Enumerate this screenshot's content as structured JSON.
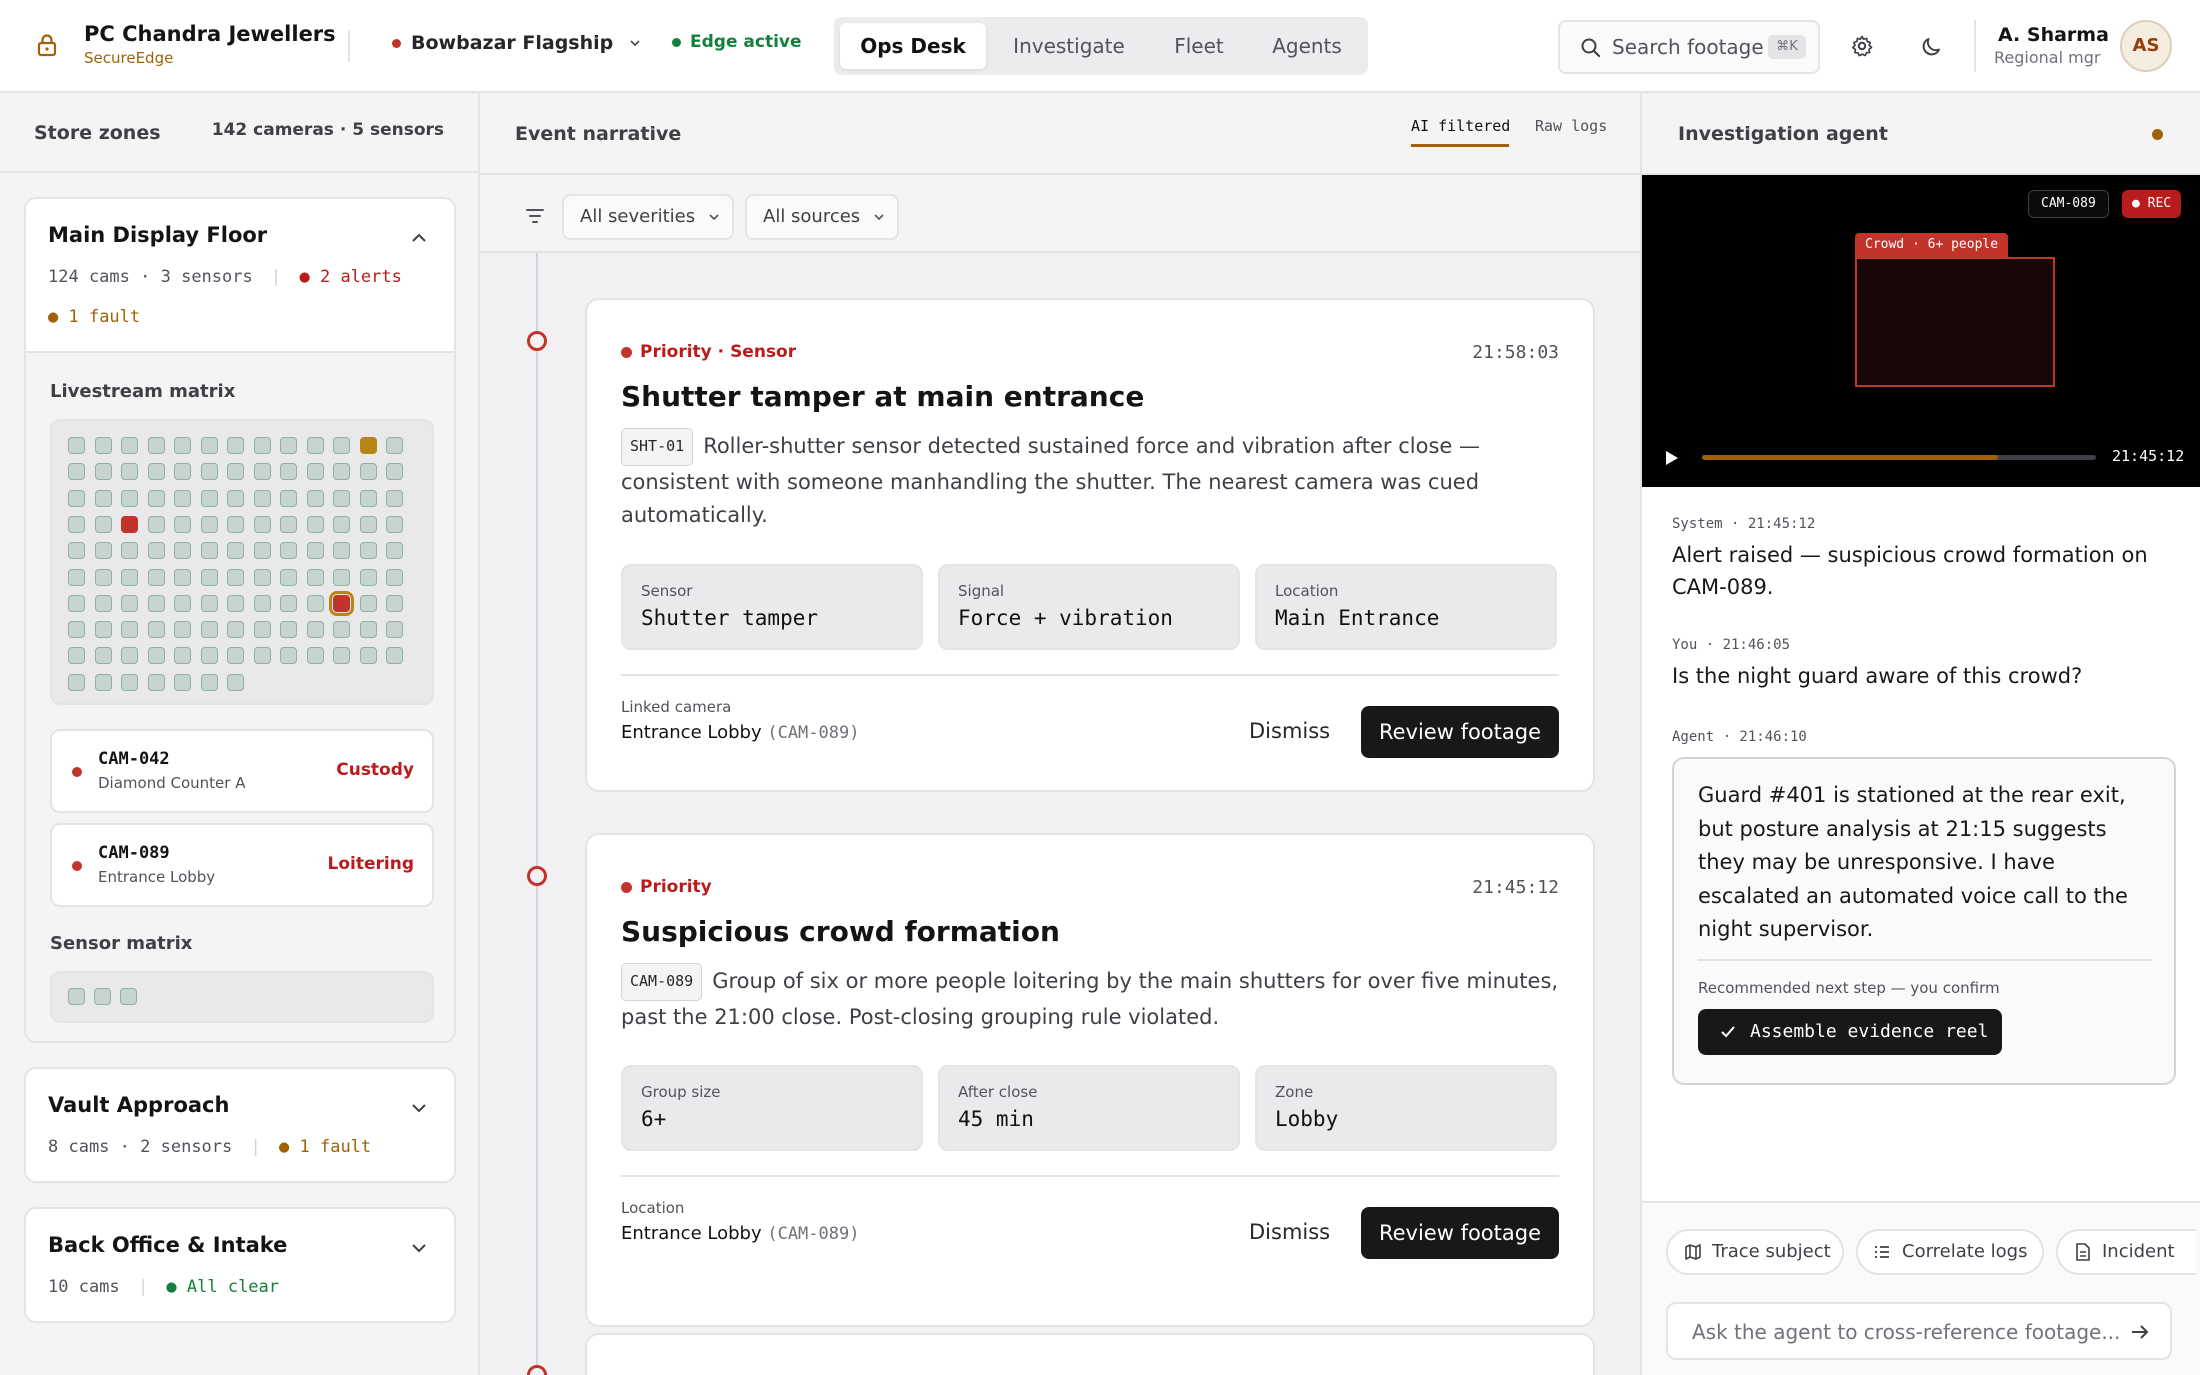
{
  "header": {
    "brand_name": "PC Chandra Jewellers",
    "brand_sub": "SecureEdge",
    "store": "Bowbazar Flagship",
    "edge_status": "Edge active",
    "tabs": [
      {
        "label": "Ops Desk",
        "active": true
      },
      {
        "label": "Investigate",
        "active": false
      },
      {
        "label": "Fleet",
        "active": false
      },
      {
        "label": "Agents",
        "active": false
      }
    ],
    "search_label": "Search footage",
    "search_kbd": "⌘K",
    "user_name": "A. Sharma",
    "user_role": "Regional mgr",
    "avatar": "AS"
  },
  "zones_panel": {
    "title": "Store zones",
    "counts": "142 cameras · 5 sensors",
    "zones": [
      {
        "name": "Main Display Floor",
        "cams": "124 cams",
        "sensors": "· 3 sensors",
        "alerts": "2 alerts",
        "fault": "1 fault",
        "expanded": true,
        "livestream_title": "Livestream matrix",
        "sensor_title": "Sensor matrix",
        "cameras": [
          {
            "id": "CAM-042",
            "location": "Diamond Counter A",
            "tag": "Custody"
          },
          {
            "id": "CAM-089",
            "location": "Entrance Lobby",
            "tag": "Loitering"
          }
        ]
      },
      {
        "name": "Vault Approach",
        "cams": "8 cams",
        "sensors": "· 2 sensors",
        "fault": "1 fault",
        "expanded": false
      },
      {
        "name": "Back Office & Intake",
        "cams": "10 cams",
        "status": "All clear",
        "expanded": false
      }
    ]
  },
  "narrative": {
    "title": "Event narrative",
    "view_ai": "AI filtered",
    "view_raw": "Raw logs",
    "filter_severity": "All severities",
    "filter_source": "All sources",
    "events": [
      {
        "priority": "Priority · Sensor",
        "time": "21:58:03",
        "title": "Shutter tamper at main entrance",
        "chip": "SHT-01",
        "desc": "Roller-shutter sensor detected sustained force and vibration after close — consistent with someone manhandling the shutter. The nearest camera was cued automatically.",
        "fields": [
          {
            "label": "Sensor",
            "value": "Shutter tamper"
          },
          {
            "label": "Signal",
            "value": "Force + vibration"
          },
          {
            "label": "Location",
            "value": "Main Entrance"
          }
        ],
        "link_label": "Linked camera",
        "link_value": "Entrance Lobby",
        "link_cam": "(CAM-089)",
        "dismiss": "Dismiss",
        "review": "Review footage"
      },
      {
        "priority": "Priority",
        "time": "21:45:12",
        "title": "Suspicious crowd formation",
        "chip": "CAM-089",
        "desc": "Group of six or more people loitering by the main shutters for over five minutes, past the 21:00 close. Post-closing grouping rule violated.",
        "fields": [
          {
            "label": "Group size",
            "value": "6+"
          },
          {
            "label": "After close",
            "value": "45 min"
          },
          {
            "label": "Zone",
            "value": "Lobby"
          }
        ],
        "link_label": "Location",
        "link_value": "Entrance Lobby",
        "link_cam": "(CAM-089)",
        "dismiss": "Dismiss",
        "review": "Review footage"
      }
    ]
  },
  "agent": {
    "title": "Investigation agent",
    "video": {
      "camera": "CAM-089",
      "rec": "REC",
      "detection": "Crowd · 6+ people",
      "timestamp": "21:45:12",
      "progress": 0.75
    },
    "messages": [
      {
        "meta": "System · 21:45:12",
        "text": "Alert raised — suspicious crowd formation on CAM-089."
      },
      {
        "meta": "You · 21:46:05",
        "text": "Is the night guard aware of this crowd?"
      },
      {
        "meta": "Agent · 21:46:10",
        "text": "Guard #401 is stationed at the rear exit, but posture analysis at 21:15 suggests they may be unresponsive. I have escalated an automated voice call to the night supervisor."
      }
    ],
    "recommend_label": "Recommended next step — you confirm",
    "recommend_action": "Assemble evidence reel",
    "tools": [
      "Trace subject",
      "Correlate logs",
      "Incident"
    ],
    "input_placeholder": "Ask the agent to cross-reference footage..."
  },
  "colors": {
    "accent": "#a16207",
    "alert": "#c2342b",
    "ok": "#15803d",
    "dark": "#18181b"
  }
}
